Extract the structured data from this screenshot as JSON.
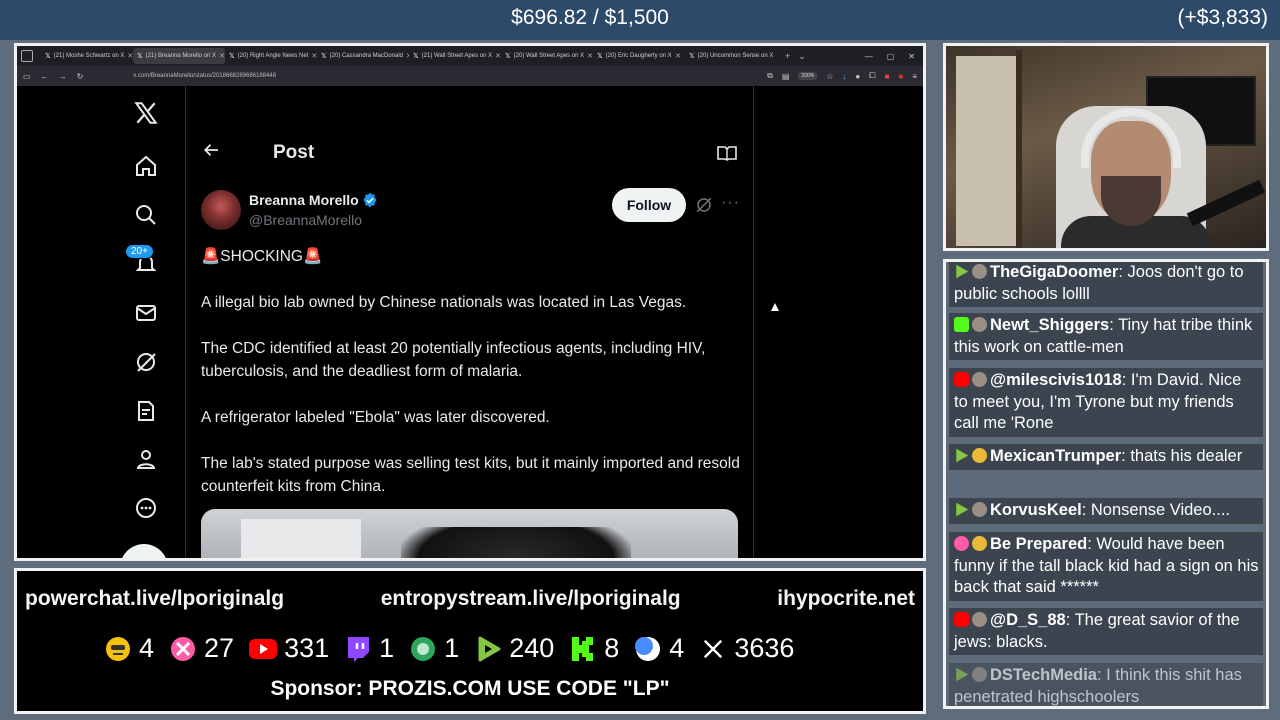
{
  "overlay": {
    "goal": "$696.82 / $1,500",
    "bonus": "(+$3,833)",
    "links": [
      "powerchat.live/lporiginalg",
      "entropystream.live/lporiginalg",
      "ihypocrite.net"
    ],
    "counts": [
      {
        "platform": "face-emoji",
        "value": "4",
        "color": "#f4c20d"
      },
      {
        "platform": "rumble-ribbon",
        "value": "27",
        "color": "#ff5ca8"
      },
      {
        "platform": "youtube",
        "value": "331",
        "color": "#ff0000"
      },
      {
        "platform": "twitch",
        "value": "1",
        "color": "#9146ff"
      },
      {
        "platform": "globe",
        "value": "1",
        "color": "#2ea55c"
      },
      {
        "platform": "rumble",
        "value": "240",
        "color": "#85c742"
      },
      {
        "platform": "kick",
        "value": "8",
        "color": "#53fc18"
      },
      {
        "platform": "moon",
        "value": "4",
        "color": "#4a8cff"
      },
      {
        "platform": "x",
        "value": "3636",
        "color": "#ffffff"
      }
    ],
    "sponsor": "Sponsor: PROZIS.COM USE CODE \"LP\""
  },
  "browser": {
    "tabs": [
      "(21) Moshe Schwartz on X",
      "(21) Breanna Morello on X",
      "(20) Right Angle News Net",
      "(20) Cassandra MacDonald",
      "(21) Wall Street Apes on X",
      "(20) Wall Street Apes on X",
      "(20) Eric Daugherty on X",
      "(20) Uncommon Sense on X"
    ],
    "active_tab_index": 1,
    "url": "x.com/BreannaMorello/status/2018668289686188448",
    "zoom": "200%"
  },
  "x": {
    "notif_badge": "20+",
    "post_header": "Post",
    "author_name": "Breanna Morello",
    "author_handle": "@BreannaMorello",
    "follow_label": "Follow",
    "post_lines": [
      "🚨SHOCKING🚨",
      "A illegal bio lab owned by Chinese nationals was located in Las Vegas.",
      "The CDC identified at least 20 potentially infectious agents, including HIV, tuberculosis, and the deadliest form of malaria.",
      "A refrigerator labeled \"Ebola\" was later discovered.",
      "The lab's stated purpose was selling test kits, but it mainly imported and resold counterfeit kits from China."
    ]
  },
  "chat": [
    {
      "badges": [
        "rumble",
        "avatar"
      ],
      "user": "TheGigaDoomer",
      "text": "Joos don't go to public schools lollll",
      "faded": false
    },
    {
      "badges": [
        "kick",
        "avatar"
      ],
      "user": "Newt_Shiggers",
      "text": "Tiny hat tribe think this work on cattle-men",
      "faded": false
    },
    {
      "badges": [
        "youtube",
        "avatar"
      ],
      "user": "@milescivis1018",
      "text": "I'm David. Nice to meet you, I'm Tyrone but my friends call me 'Rone",
      "faded": false
    },
    {
      "badges": [
        "rumble",
        "gold"
      ],
      "user": "MexicanTrumper",
      "text": "thats his dealer",
      "faded": false
    },
    {
      "badges": [
        "rumble",
        "avatar"
      ],
      "user": "KorvusKeel",
      "text": "Nonsense Video....",
      "faded": false
    },
    {
      "badges": [
        "pink",
        "gold"
      ],
      "user": "Be Prepared",
      "text": "Would have been funny if the tall black kid had a sign on his back that said ******",
      "faded": false
    },
    {
      "badges": [
        "youtube",
        "avatar"
      ],
      "user": "@D_S_88",
      "text": "The great savior of the jews: blacks.",
      "faded": false
    },
    {
      "badges": [
        "rumble",
        "avatar"
      ],
      "user": "DSTechMedia",
      "text": "I think this shit has penetrated highschoolers",
      "faded": true
    }
  ]
}
